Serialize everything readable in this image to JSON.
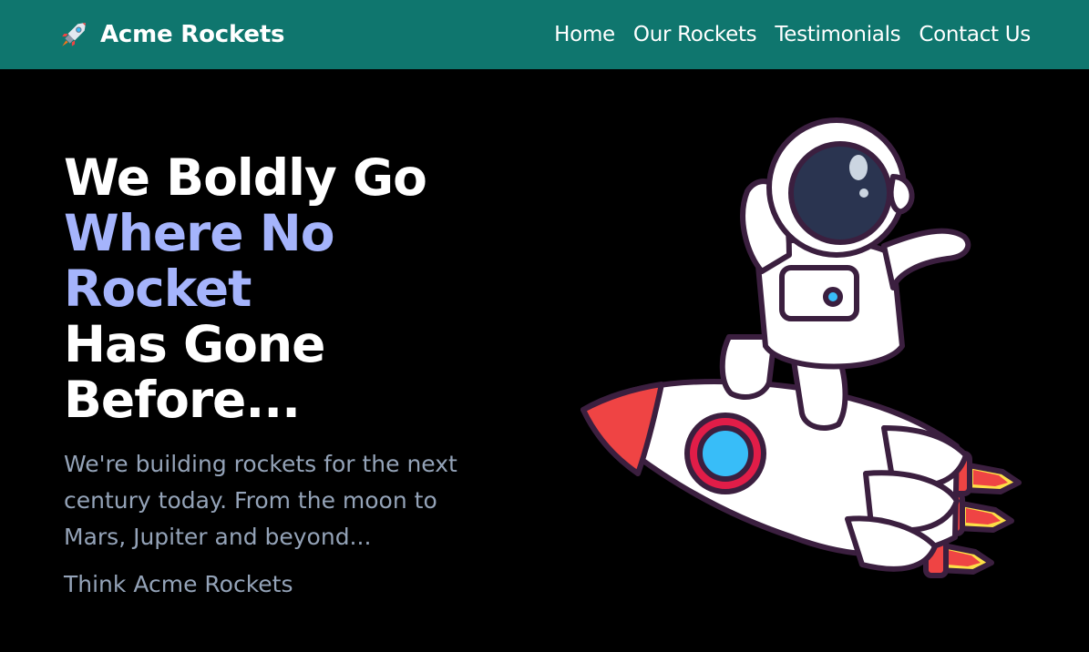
{
  "brand": {
    "name": "Acme Rockets",
    "icon": "rocket-icon"
  },
  "nav": {
    "items": [
      {
        "label": "Home"
      },
      {
        "label": "Our Rockets"
      },
      {
        "label": "Testimonials"
      },
      {
        "label": "Contact Us"
      }
    ]
  },
  "hero": {
    "headline_line1": "We Boldly Go",
    "headline_accent": "Where No Rocket",
    "headline_line3": "Has Gone",
    "headline_line4": "Before...",
    "tagline": "We're building rockets for the next century today. From the moon to Mars, Jupiter and beyond...",
    "slogan": "Think Acme Rockets",
    "image": "astronaut-riding-rocket-illustration"
  },
  "colors": {
    "navbar": "#0f766e",
    "background": "#000000",
    "accent": "#a5b4fc",
    "muted_text": "#94a3b8"
  }
}
